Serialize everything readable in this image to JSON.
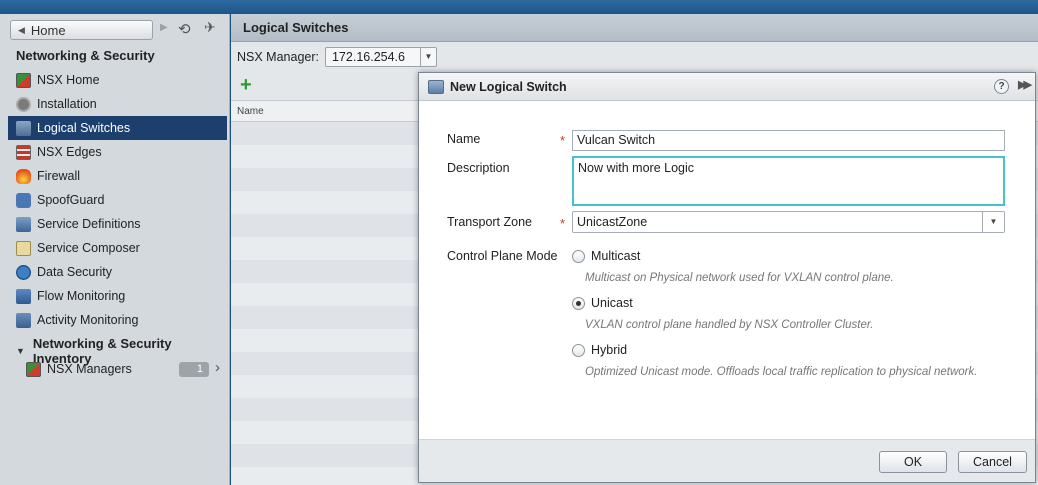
{
  "nav": {
    "home_label": "Home",
    "section_title": "Networking & Security",
    "items": [
      {
        "label": "NSX Home",
        "icon": "nsx-home-icon"
      },
      {
        "label": "Installation",
        "icon": "gear-icon"
      },
      {
        "label": "Logical Switches",
        "icon": "logical-switch-icon",
        "active": true
      },
      {
        "label": "NSX Edges",
        "icon": "edge-icon"
      },
      {
        "label": "Firewall",
        "icon": "firewall-icon"
      },
      {
        "label": "SpoofGuard",
        "icon": "spoofguard-icon"
      },
      {
        "label": "Service Definitions",
        "icon": "service-definitions-icon"
      },
      {
        "label": "Service Composer",
        "icon": "service-composer-icon"
      },
      {
        "label": "Data Security",
        "icon": "data-security-icon"
      },
      {
        "label": "Flow Monitoring",
        "icon": "flow-monitoring-icon"
      },
      {
        "label": "Activity Monitoring",
        "icon": "activity-monitoring-icon"
      }
    ],
    "inventory_title": "Networking & Security Inventory",
    "nsx_managers_label": "NSX Managers",
    "nsx_managers_count": "1"
  },
  "main": {
    "title": "Logical Switches",
    "manager_label": "NSX Manager:",
    "manager_value": "172.16.254.6",
    "column_name": "Name"
  },
  "dialog": {
    "title": "New Logical Switch",
    "help_glyph": "?",
    "name_label": "Name",
    "name_value": "Vulcan Switch",
    "required_mark": "*",
    "description_label": "Description",
    "description_value": "Now with more Logic",
    "transport_zone_label": "Transport Zone",
    "transport_zone_value": "UnicastZone",
    "control_plane_label": "Control Plane Mode",
    "modes": [
      {
        "label": "Multicast",
        "hint": "Multicast on Physical network used for VXLAN control plane.",
        "selected": false
      },
      {
        "label": "Unicast",
        "hint": "VXLAN control plane handled by NSX Controller Cluster.",
        "selected": true
      },
      {
        "label": "Hybrid",
        "hint": "Optimized Unicast mode. Offloads local traffic replication to physical network.",
        "selected": false
      }
    ],
    "ok_label": "OK",
    "cancel_label": "Cancel"
  }
}
